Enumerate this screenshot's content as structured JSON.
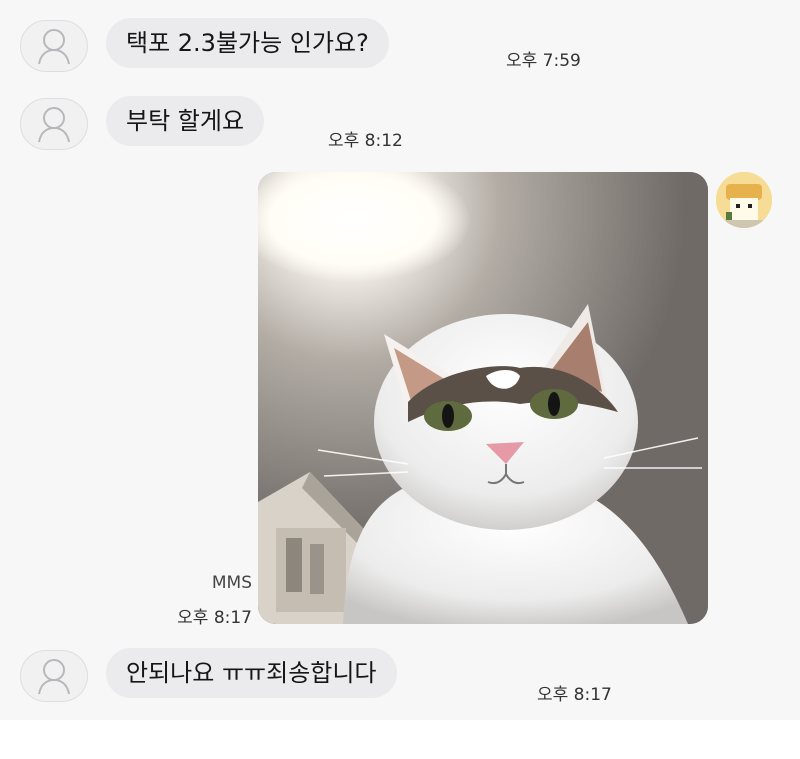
{
  "messages": [
    {
      "text": "택포 2.3불가능 인가요?",
      "time": "오후 7:59"
    },
    {
      "text": "부탁 할게요",
      "time": "오후 8:12"
    },
    {
      "text": "안되나요 ㅠㅠ죄송합니다",
      "time": "오후 8:17"
    }
  ],
  "sent_media": {
    "type_label": "MMS",
    "time": "오후 8:17"
  },
  "icons": {
    "contact_avatar": "person-outline-icon",
    "my_avatar": "profile-picture-icon"
  },
  "colors": {
    "bubble": "#ebebed",
    "background": "#f7f7f8"
  }
}
